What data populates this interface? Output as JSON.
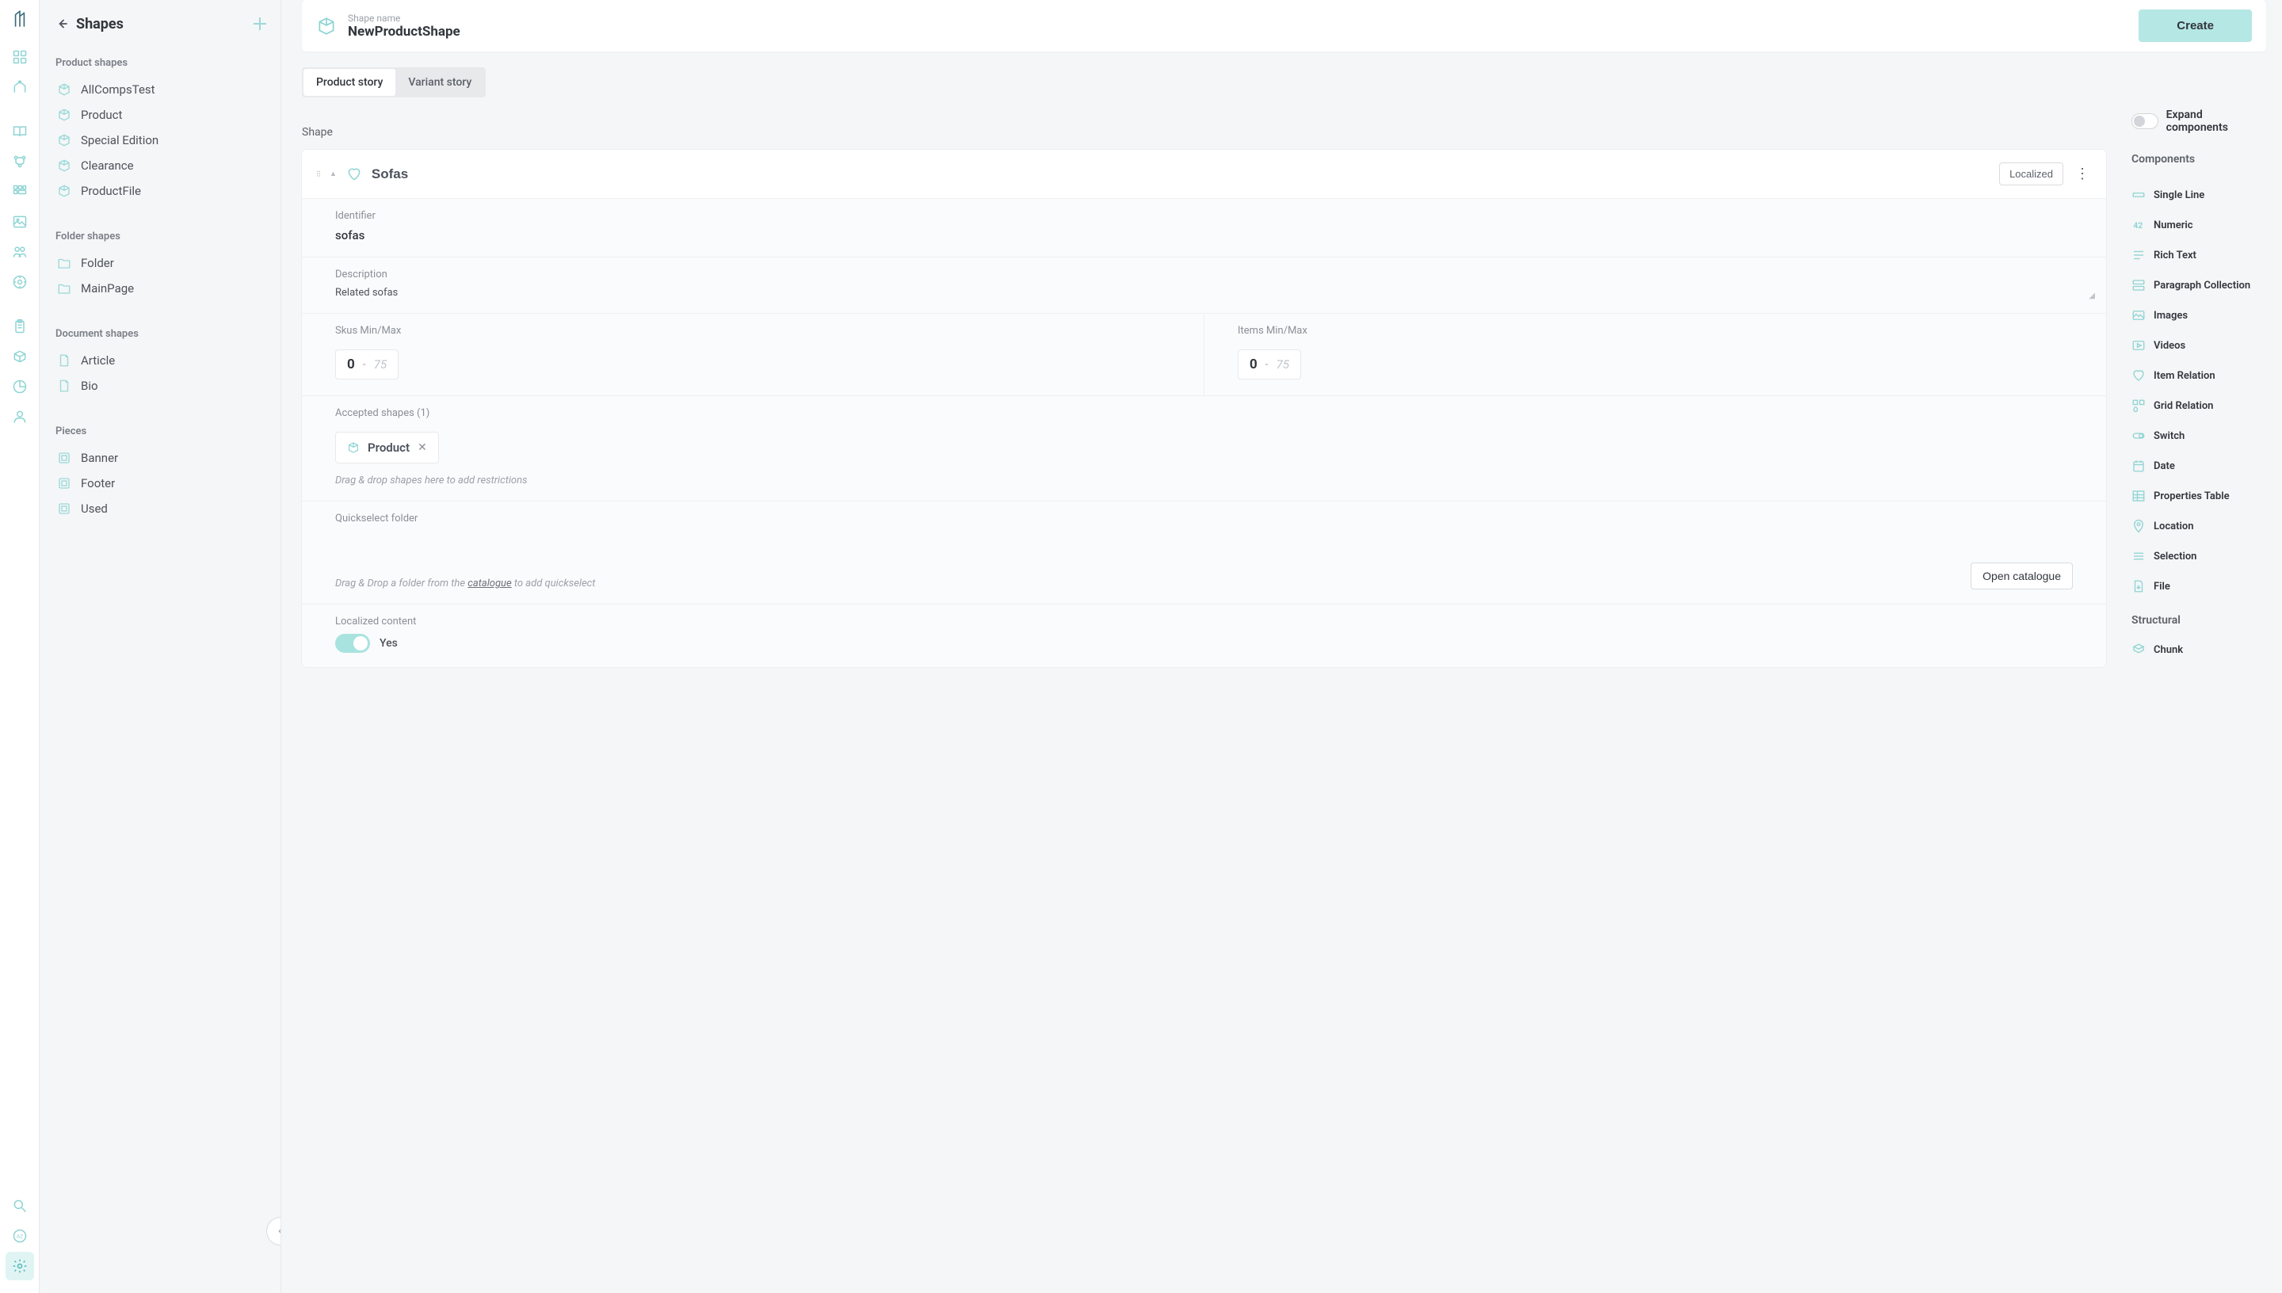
{
  "sidebar": {
    "title": "Shapes",
    "sections": [
      {
        "title": "Product shapes",
        "items": [
          "AllCompsTest",
          "Product",
          "Special Edition",
          "Clearance",
          "ProductFile"
        ]
      },
      {
        "title": "Folder shapes",
        "items": [
          "Folder",
          "MainPage"
        ]
      },
      {
        "title": "Document shapes",
        "items": [
          "Article",
          "Bio"
        ]
      },
      {
        "title": "Pieces",
        "items": [
          "Banner",
          "Footer",
          "Used"
        ]
      }
    ]
  },
  "header": {
    "shape_name_label": "Shape name",
    "shape_name": "NewProductShape",
    "create_label": "Create"
  },
  "tabs": [
    {
      "label": "Product story",
      "active": true
    },
    {
      "label": "Variant story",
      "active": false
    }
  ],
  "shape_label": "Shape",
  "expand_label": "Expand components",
  "card": {
    "title": "Sofas",
    "localized_chip": "Localized",
    "identifier_label": "Identifier",
    "identifier_value": "sofas",
    "description_label": "Description",
    "description_value": "Related sofas",
    "skus_label": "Skus Min/Max",
    "items_label": "Items Min/Max",
    "skus_min": "0",
    "skus_ph": "75",
    "items_min": "0",
    "items_ph": "75",
    "accepted_label": "Accepted shapes (1)",
    "accepted_chip": "Product",
    "accepted_hint": "Drag & drop shapes here to add restrictions",
    "quickselect_label": "Quickselect folder",
    "quickselect_hint_pre": "Drag & Drop a folder from the ",
    "quickselect_hint_link": "catalogue",
    "quickselect_hint_post": " to add quickselect",
    "open_catalogue_label": "Open catalogue",
    "localized_content_label": "Localized content",
    "localized_yes": "Yes"
  },
  "components": {
    "title": "Components",
    "items": [
      "Single Line",
      "Numeric",
      "Rich Text",
      "Paragraph Collection",
      "Images",
      "Videos",
      "Item Relation",
      "Grid Relation",
      "Switch",
      "Date",
      "Properties Table",
      "Location",
      "Selection",
      "File"
    ],
    "structural_title": "Structural",
    "structural_items": [
      "Chunk"
    ]
  }
}
